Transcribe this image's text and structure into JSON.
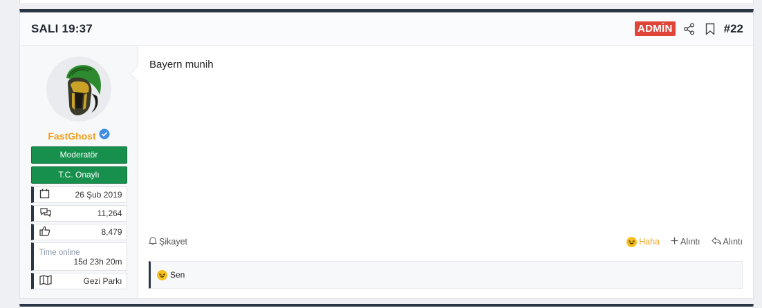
{
  "post": {
    "title": "SALI 19:37",
    "admin_badge": "ADMİN",
    "number": "#22",
    "message": "Bayern munih"
  },
  "user": {
    "name": "FastGhost",
    "verified": true,
    "roles": [
      "Moderatör",
      "T.C. Onaylı"
    ],
    "stats": {
      "joined": "26 Şub 2019",
      "messages": "11,264",
      "reactions": "8,479",
      "time_online_label": "Time online",
      "time_online": "15d 23h 20m",
      "location": "Gezi Parkı"
    }
  },
  "actions": {
    "report": "Şikayet",
    "reaction": "Haha",
    "quote": "Alıntı",
    "reply": "Alıntı"
  },
  "reactions_bar": {
    "text": "Sen"
  },
  "colors": {
    "admin": "#e0453a",
    "username": "#f0a01e",
    "role": "#17904d",
    "accent_dark": "#2a3545"
  }
}
